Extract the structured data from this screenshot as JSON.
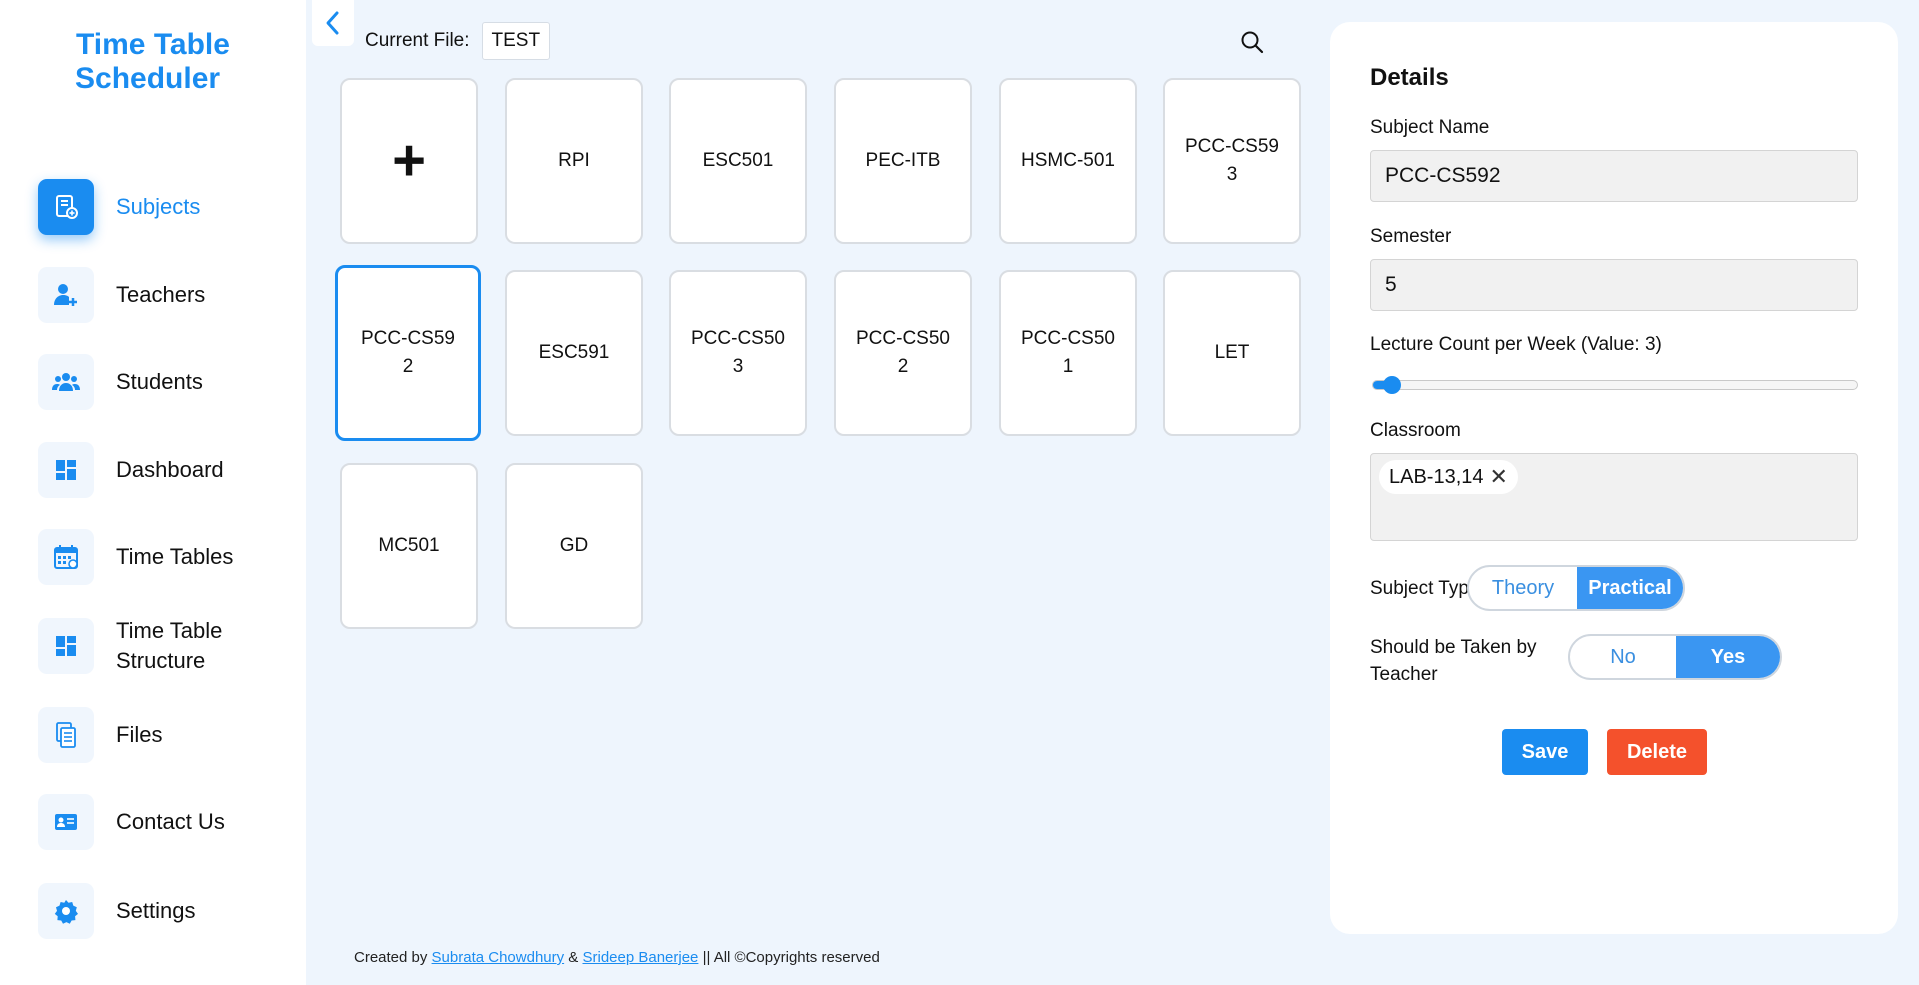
{
  "app": {
    "title_line1": "Time Table",
    "title_line2": "Scheduler"
  },
  "sidebar": {
    "items": [
      {
        "label": "Subjects",
        "icon": "subjects-icon",
        "active": true
      },
      {
        "label": "Teachers",
        "icon": "add-user-icon"
      },
      {
        "label": "Students",
        "icon": "users-group-icon"
      },
      {
        "label": "Dashboard",
        "icon": "dashboard-icon"
      },
      {
        "label": "Time Tables",
        "icon": "calendar-icon"
      },
      {
        "label_line1": "Time Table",
        "label_line2": "Structure",
        "icon": "dashboard-icon"
      },
      {
        "label": "Files",
        "icon": "files-icon"
      },
      {
        "label": "Contact Us",
        "icon": "contact-card-icon"
      },
      {
        "label": "Settings",
        "icon": "gear-icon"
      }
    ]
  },
  "toolbar": {
    "current_file_label": "Current File:",
    "current_file_value": "TEST"
  },
  "subjects": [
    {
      "label": "+"
    },
    {
      "label": "RPI"
    },
    {
      "label": "ESC501"
    },
    {
      "label": "PEC-ITB"
    },
    {
      "label": "HSMC-501"
    },
    {
      "label": "PCC-CS593"
    },
    {
      "label": "PCC-CS592",
      "selected": true
    },
    {
      "label": "ESC591"
    },
    {
      "label": "PCC-CS503"
    },
    {
      "label": "PCC-CS502"
    },
    {
      "label": "PCC-CS501"
    },
    {
      "label": "LET"
    },
    {
      "label": "MC501"
    },
    {
      "label": "GD"
    }
  ],
  "details": {
    "title": "Details",
    "subject_name_label": "Subject Name",
    "subject_name_value": "PCC-CS592",
    "semester_label": "Semester",
    "semester_value": "5",
    "lecture_label": "Lecture Count per Week (Value: 3)",
    "lecture_fraction": 0.04,
    "classroom_label": "Classroom",
    "classroom_chip": "LAB-13,14",
    "classroom_chip_remove": "✕",
    "subject_type_label": "Subject Type",
    "subject_type_options": [
      "Theory",
      "Practical"
    ],
    "subject_type_selected": "Practical",
    "teacher_label_line1": "Should be Taken by",
    "teacher_label_line2": "Teacher",
    "teacher_options": [
      "No",
      "Yes"
    ],
    "teacher_selected": "Yes",
    "save_label": "Save",
    "delete_label": "Delete"
  },
  "footer": {
    "prefix": "Created by",
    "author1": "Subrata Chowdhury",
    "amp": "&",
    "author2": "Srideep Banerjee",
    "suffix": "|| All ©Copyrights reserved"
  },
  "colors": {
    "accent": "#1a8cf0",
    "delete": "#f4512c",
    "background": "#eef5fd"
  }
}
